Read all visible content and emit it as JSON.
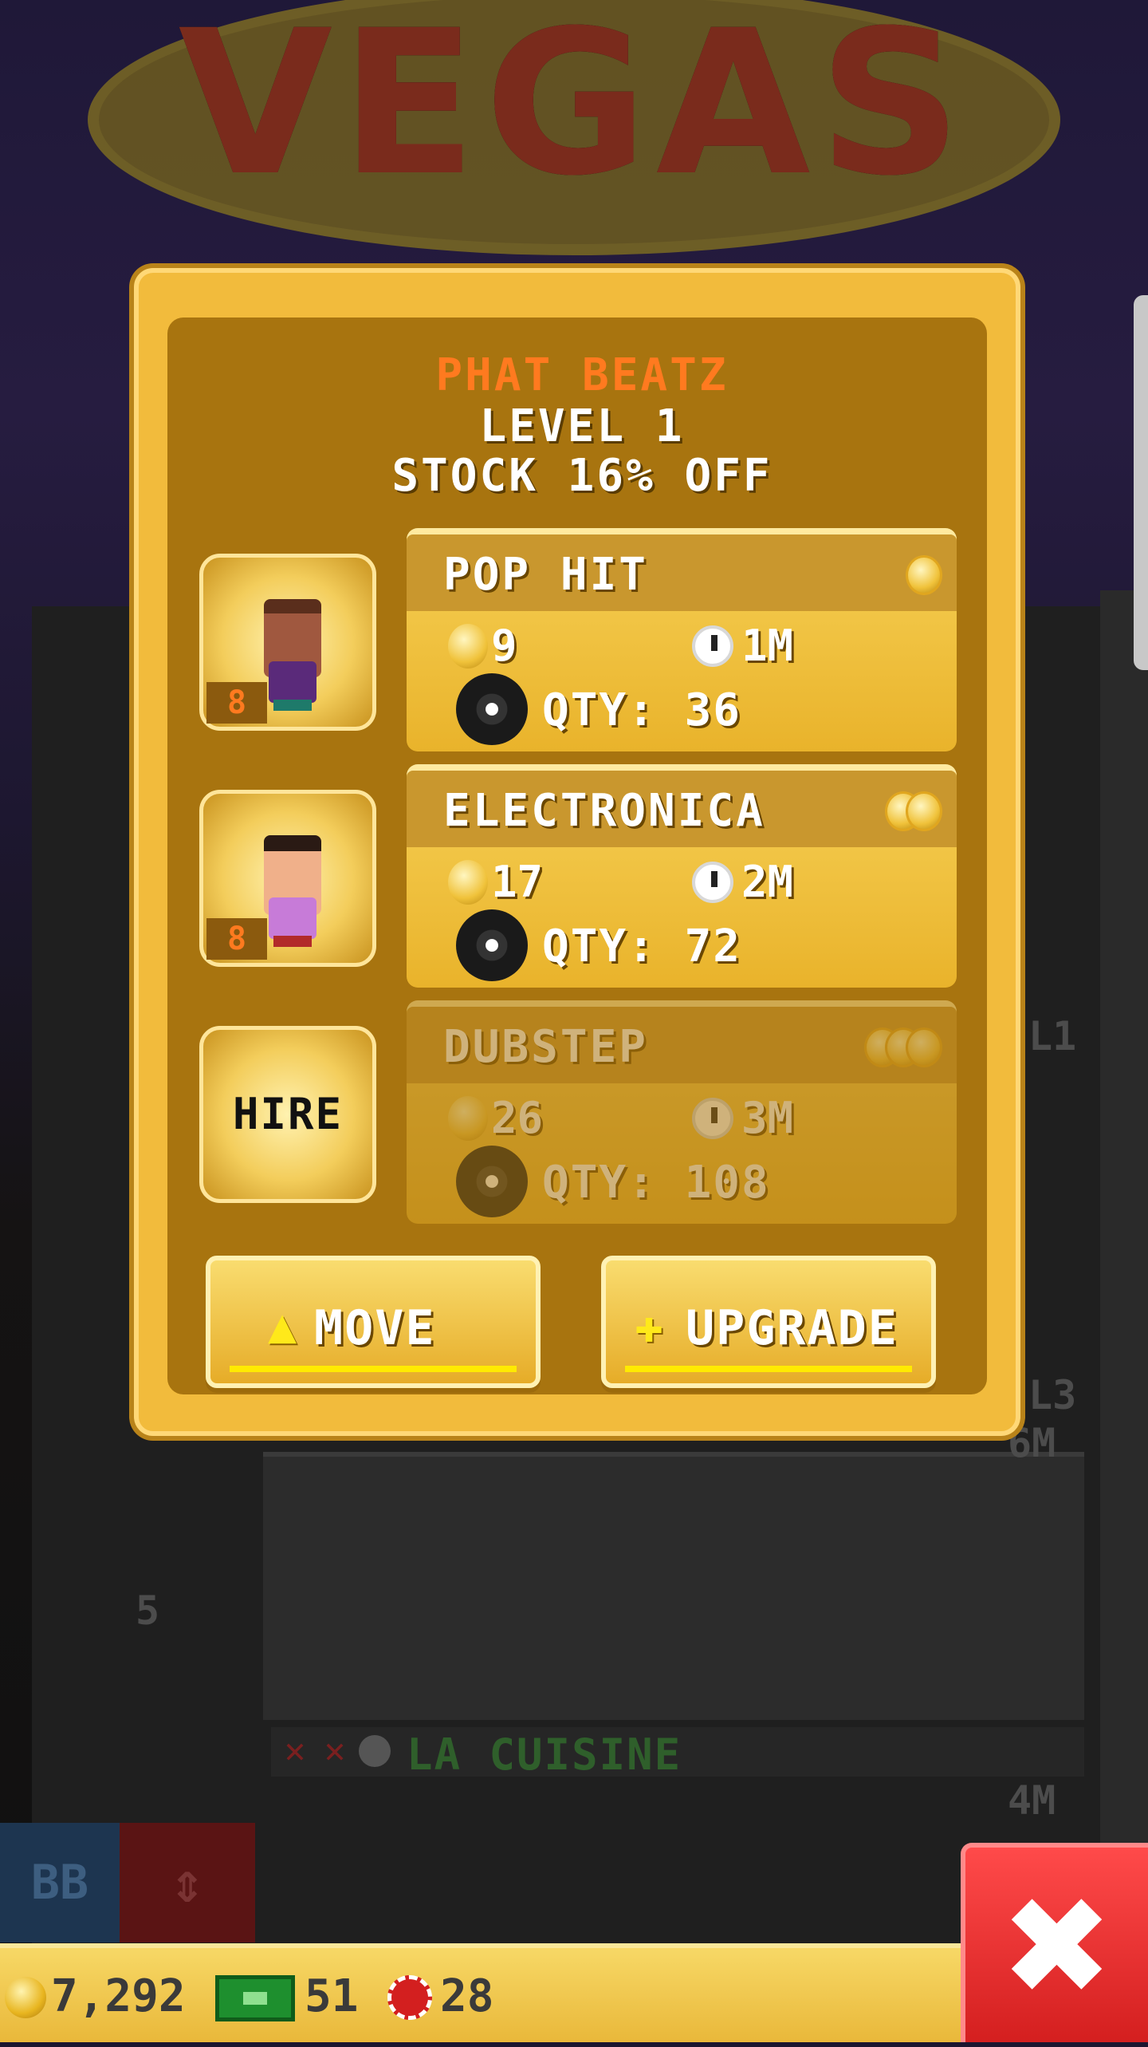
{
  "background": {
    "sign_text": "VEGAS",
    "floor_name": "LA CUISINE",
    "floor_level_labels": [
      "L1",
      "L3",
      "6M",
      "L3",
      "4M"
    ],
    "floor_number": "5",
    "bb_label": "BB"
  },
  "popup": {
    "shop_name": "PHAT BEATZ",
    "level": "LEVEL 1",
    "discount": "STOCK 16% OFF",
    "workers": [
      {
        "badge": "8",
        "hired": true
      },
      {
        "badge": "8",
        "hired": true
      },
      {
        "hired": false,
        "label": "HIRE"
      }
    ],
    "stock_items": [
      {
        "name": "POP HIT",
        "cost": "9",
        "time": "1M",
        "qty": "QTY: 36",
        "tier": 1,
        "locked": false
      },
      {
        "name": "ELECTRONICA",
        "cost": "17",
        "time": "2M",
        "qty": "QTY: 72",
        "tier": 2,
        "locked": false
      },
      {
        "name": "DUBSTEP",
        "cost": "26",
        "time": "3M",
        "qty": "QTY: 108",
        "tier": 3,
        "locked": true
      }
    ],
    "move_label": "MOVE",
    "upgrade_label": "UPGRADE"
  },
  "bottom_bar": {
    "coins": "7,292",
    "bux": "51",
    "chips": "28"
  },
  "colors": {
    "popup_gold": "#f2bb3c",
    "popup_inner": "#a8740f",
    "shop_name_orange": "#ff7a1f",
    "close_red": "#d41f1f"
  },
  "icons": [
    "coin-icon",
    "clock-icon",
    "record-icon",
    "arrow-up-icon",
    "plus-icon",
    "bux-icon",
    "chip-icon",
    "close-icon"
  ]
}
